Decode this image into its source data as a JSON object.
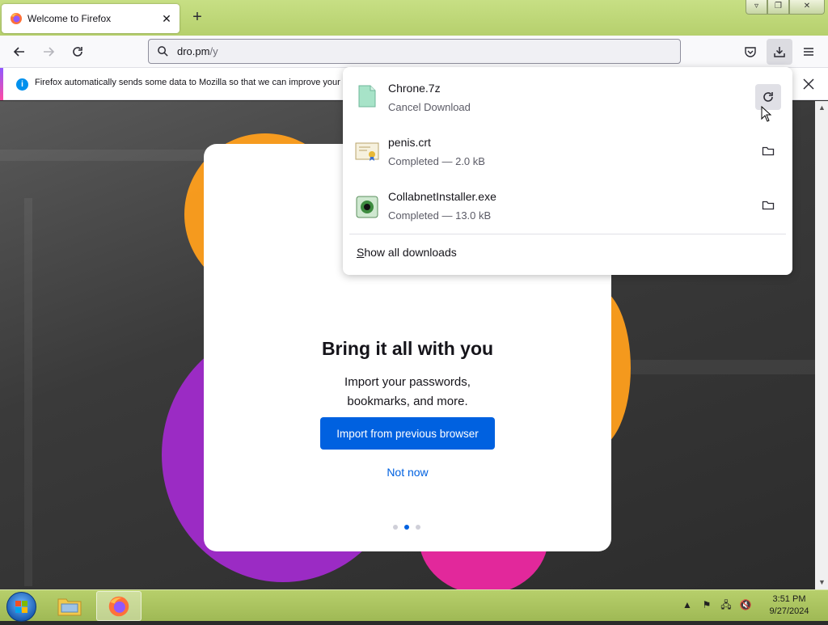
{
  "tab": {
    "title": "Welcome to Firefox"
  },
  "window_controls": {
    "minimize": "▿",
    "maximize": "❐",
    "close": "✕"
  },
  "urlbar": {
    "host": "dro.pm",
    "path": "/y"
  },
  "notification": {
    "text": "Firefox automatically sends some data to Mozilla so that we can improve your e"
  },
  "onboarding": {
    "title": "Bring it all with you",
    "subtitle_line1": "Import your passwords,",
    "subtitle_line2": "bookmarks, and more.",
    "primary_button": "Import from previous browser",
    "secondary_link": "Not now",
    "step_count": 3,
    "active_step": 2
  },
  "downloads": {
    "items": [
      {
        "name": "Chrone.7z",
        "status": "Cancel Download",
        "icon": "archive-file-icon",
        "action": "retry-icon"
      },
      {
        "name": "penis.crt",
        "status": "Completed — 2.0 kB",
        "icon": "certificate-file-icon",
        "action": "folder-icon"
      },
      {
        "name": "CollabnetInstaller.exe",
        "status": "Completed — 13.0 kB",
        "icon": "installer-file-icon",
        "action": "folder-icon"
      }
    ],
    "show_all": "Show all downloads",
    "show_all_accesskey": "S",
    "show_all_rest": "how all downloads"
  },
  "taskbar": {
    "clock_time": "3:51 PM",
    "clock_date": "9/27/2024"
  },
  "colors": {
    "accent_blue": "#0061e0",
    "taskbar_green": "#b7cf6b",
    "blob_orange": "#ff9f1c",
    "blob_purple": "#9b2bc4",
    "blob_pink": "#e2289b"
  }
}
